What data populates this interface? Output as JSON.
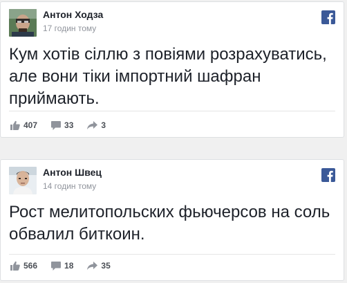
{
  "colors": {
    "text": "#1d2129",
    "muted": "#90949c",
    "facebook_blue": "#3b5998",
    "stat_text": "#4b4f56"
  },
  "posts": [
    {
      "author": "Антон Ходза",
      "time": "17 годин тому",
      "text": "Кум хотів сіллю з повіями розрахуватись, але вони тіки імпортний шафран приймають.",
      "likes": "407",
      "comments": "33",
      "shares": "3",
      "icons": [
        "avatar",
        "facebook-icon",
        "like-icon",
        "comment-icon",
        "share-icon"
      ]
    },
    {
      "author": "Антон Швец",
      "time": "14 годин тому",
      "text": "Рост мелитопольских фьючерсов на соль обвалил биткоин.",
      "likes": "566",
      "comments": "18",
      "shares": "35",
      "icons": [
        "avatar",
        "facebook-icon",
        "like-icon",
        "comment-icon",
        "share-icon"
      ]
    }
  ]
}
